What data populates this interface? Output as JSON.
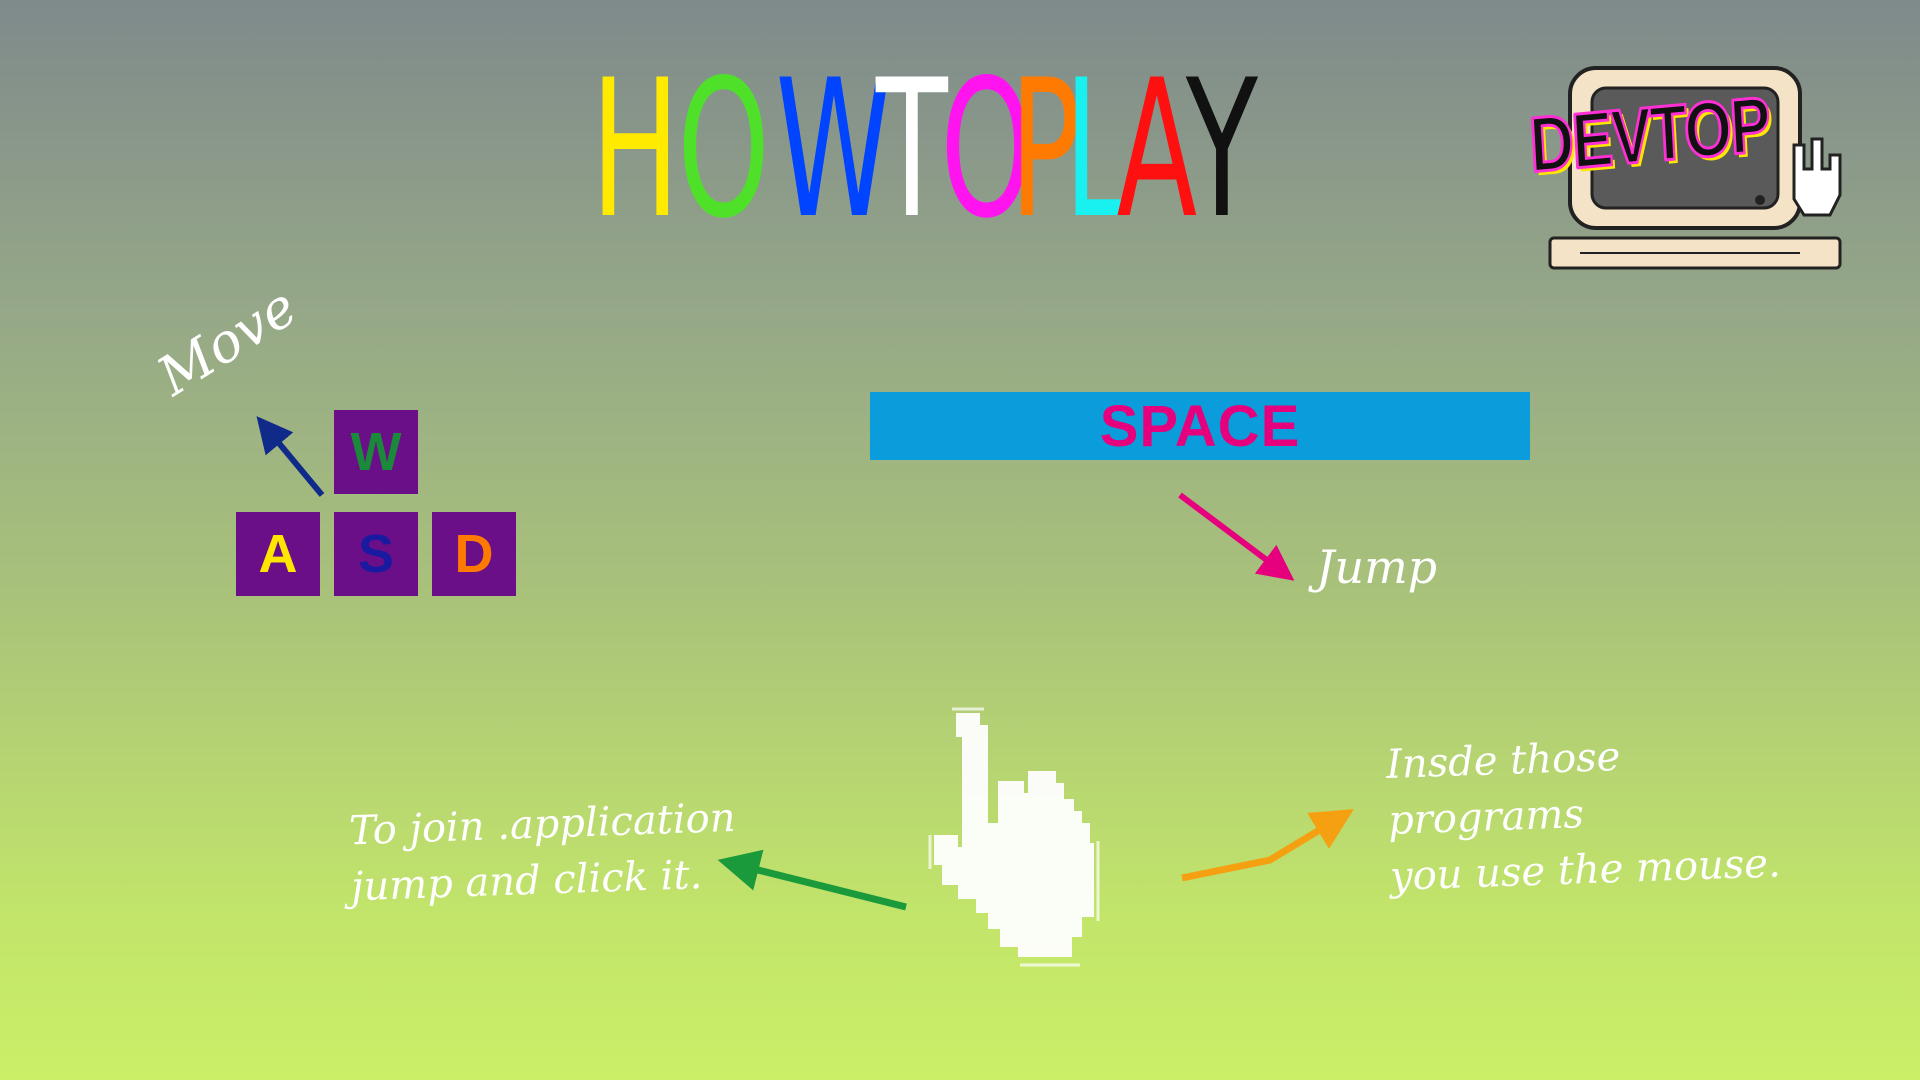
{
  "title": {
    "letters": [
      {
        "char": "H",
        "color": "#ffea00"
      },
      {
        "char": "O",
        "color": "#4fe02a"
      },
      {
        "char": "W",
        "color": "#0044ff"
      },
      {
        "char": " ",
        "color": "#ffffff"
      },
      {
        "char": "T",
        "color": "#ffffff"
      },
      {
        "char": "O",
        "color": "#ff14f0"
      },
      {
        "char": " ",
        "color": "#ffffff"
      },
      {
        "char": "P",
        "color": "#ff7a00"
      },
      {
        "char": "L",
        "color": "#19f0f0"
      },
      {
        "char": "A",
        "color": "#ff1010"
      },
      {
        "char": "Y",
        "color": "#111111"
      }
    ]
  },
  "logo": {
    "text": "DEVTOP"
  },
  "move": {
    "label": "Move",
    "keys": [
      {
        "letter": "W",
        "color": "#1a8a3a"
      },
      {
        "letter": "A",
        "color": "#ffe600"
      },
      {
        "letter": "S",
        "color": "#1a1aa0"
      },
      {
        "letter": "D",
        "color": "#ff7a00"
      }
    ],
    "arrow_color": "#102a8a"
  },
  "jump": {
    "key_label": "SPACE",
    "label": "Jump",
    "arrow_color": "#e6007e"
  },
  "mouse": {
    "icon": "pointing-hand-cursor-icon",
    "left_note": [
      "To join .application",
      "jump and click it."
    ],
    "right_note": [
      "Insde those programs",
      "you use the mouse."
    ],
    "left_arrow_color": "#1a9a3a",
    "right_arrow_color": "#f5a010"
  }
}
